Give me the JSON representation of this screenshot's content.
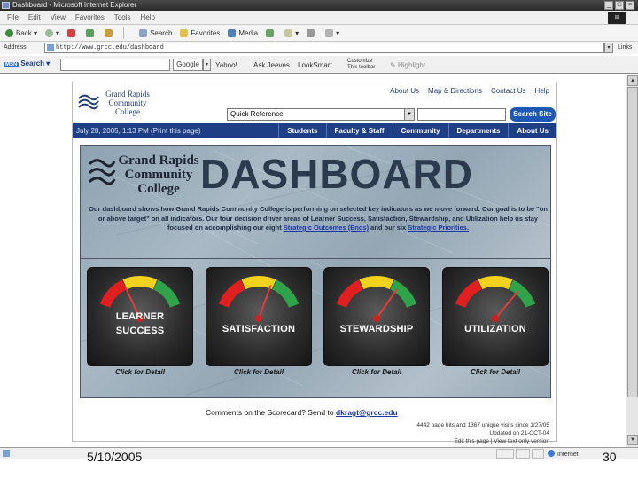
{
  "window": {
    "title": "Dashboard - Microsoft Internet Explorer"
  },
  "menu": [
    "File",
    "Edit",
    "View",
    "Favorites",
    "Tools",
    "Help"
  ],
  "toolbar": {
    "back": "Back",
    "search": "Search",
    "favorites": "Favorites",
    "media": "Media"
  },
  "address": {
    "label": "Address",
    "url": "http://www.grcc.edu/dashboard",
    "links": "Links"
  },
  "googlebar": {
    "msn_badge": "MSN",
    "msn_label": "Search",
    "google": "Google",
    "yahoo": "Yahoo!",
    "ask_jeeves": "Ask Jeeves",
    "looksmart": "LookSmart",
    "customize_line1": "Customize",
    "customize_line2": "This toolbar",
    "highlight": "Highlight"
  },
  "site": {
    "logo": "Grand Rapids Community College",
    "toplinks": [
      "About Us",
      "Map & Directions",
      "Contact Us",
      "Help"
    ],
    "quick_reference": "Quick Reference",
    "search_button": "Search Site",
    "date": "July 28, 2005, 1:13 PM    (Print this page)",
    "nav": [
      "Students",
      "Faculty & Staff",
      "Community",
      "Departments",
      "About Us"
    ]
  },
  "dashboard": {
    "logo": "Grand Rapids Community College",
    "title": "DASHBOARD",
    "intro_text": "Our dashboard shows how Grand Rapids Community College is performing on selected key indicators as we move forward. Our goal is to be \"on or above target\" on all indicators. Our four decision driver areas of Learner Success, Satisfaction, Stewardship, and Utilization help us stay focused on accomplishing our eight",
    "strategic_outcomes_link": "Strategic Outcomes (Ends)",
    "intro_tail": "and our six",
    "strategic_priorities_link": "Strategic Priorities.",
    "gauges": [
      {
        "label_line1": "LEARNER",
        "label_line2": "SUCCESS",
        "detail": "Click for Detail",
        "needle_deg": -25
      },
      {
        "label_line1": "",
        "label_line2": "SATISFACTION",
        "detail": "Click for Detail",
        "needle_deg": 20
      },
      {
        "label_line1": "",
        "label_line2": "STEWARDSHIP",
        "detail": "Click for Detail",
        "needle_deg": 35
      },
      {
        "label_line1": "",
        "label_line2": "UTILIZATION",
        "detail": "Click for Detail",
        "needle_deg": 40
      }
    ],
    "comments_prefix": "Comments on the Scorecard? Send to",
    "comments_email": "dkragt@grcc.edu",
    "footer": [
      "4442 page hits and 1367 unique visits since 1/27/05",
      "Updated on 21-OCT-04",
      "Edit this page | View text only version"
    ]
  },
  "statusbar": {
    "zone": "Internet"
  },
  "slide": {
    "date": "5/10/2005",
    "number": "30"
  },
  "colors": {
    "nav_blue": "#1e3f86",
    "link_blue": "#1c36a8",
    "gauge_red": "#e02020",
    "gauge_yellow": "#f2d21c",
    "gauge_green": "#2fa24a"
  }
}
